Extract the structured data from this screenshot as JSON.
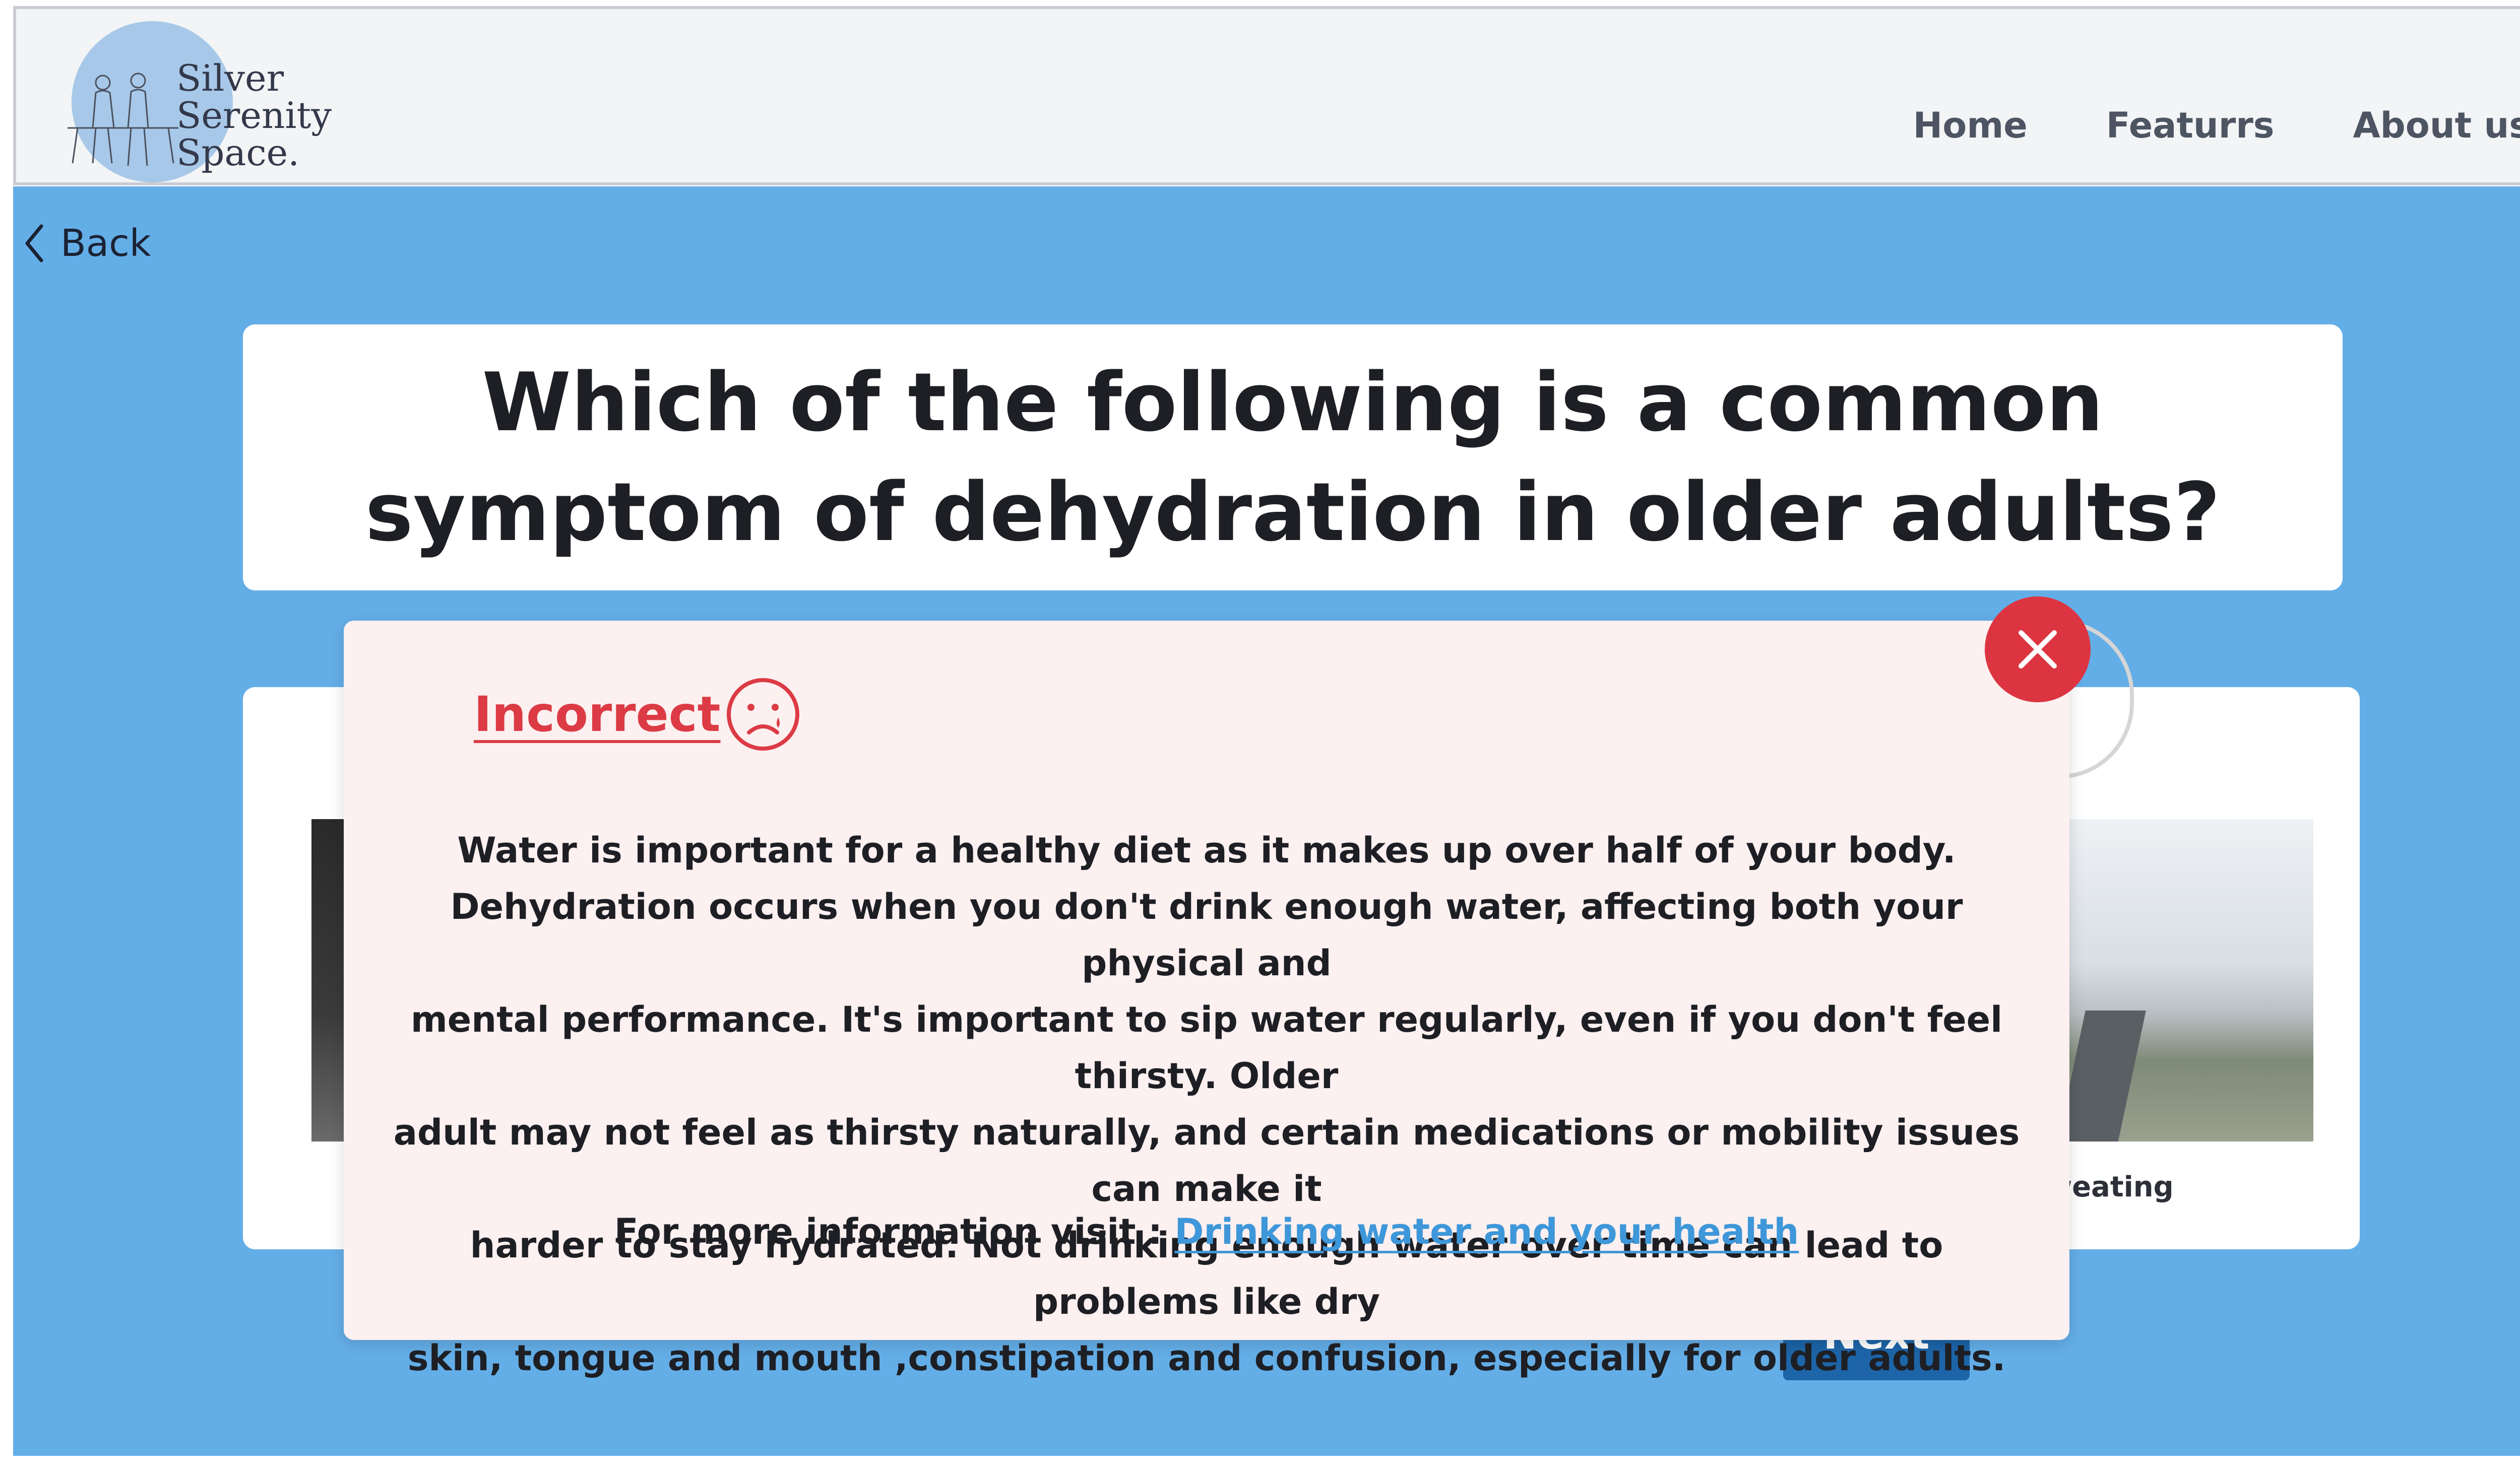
{
  "brand": {
    "logo_lines": [
      "Silver",
      "Serenity",
      "Space."
    ],
    "colors": {
      "logo_circle": "#a7c8e8",
      "main_bg": "#64aee8",
      "error_red": "#dc3b45",
      "link_blue": "#3e97d9",
      "next_blue": "#1d65a8"
    }
  },
  "nav": {
    "items": [
      "Home",
      "Featurrs",
      "About us"
    ]
  },
  "back": {
    "label": "Back",
    "icon": "chevron-left-icon"
  },
  "question": {
    "text": "Which of the following is a common symptom of dehydration in older adults?"
  },
  "options": {
    "right_label": "sweating"
  },
  "next_button": {
    "label": "Next"
  },
  "modal": {
    "title": "Incorrect",
    "title_icon": "sad-face-icon",
    "body_lines": [
      "Water is important for a healthy diet as it makes up over half of your body.",
      "Dehydration occurs when you don't drink enough water, affecting both your physical and",
      "mental performance. It's important to sip water regularly, even if you don't feel thirsty. Older",
      "adult may not feel as thirsty naturally, and certain medications or mobility issues can make it",
      "harder to stay hydrated. Not drinking enough water over time can lead to problems like dry",
      "skin, tongue and mouth ,constipation and confusion, especially for older adults."
    ],
    "info_prefix": "For more information visit : ",
    "info_link": "Drinking water and your health",
    "close_icon": "close-icon"
  }
}
